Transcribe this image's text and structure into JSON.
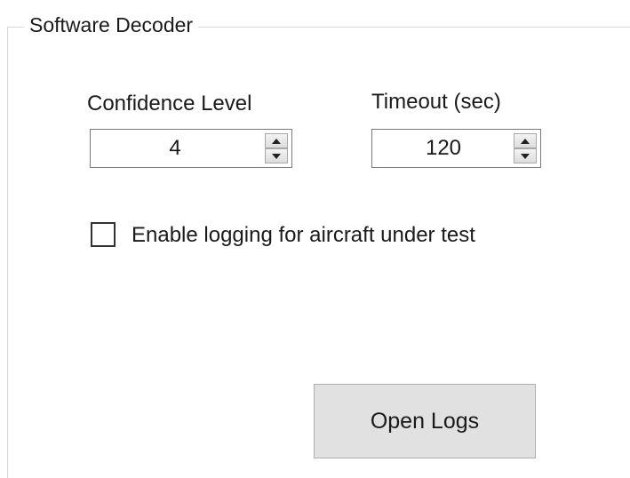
{
  "group": {
    "title": "Software Decoder"
  },
  "confidence": {
    "label": "Confidence Level",
    "value": "4"
  },
  "timeout": {
    "label": "Timeout (sec)",
    "value": "120"
  },
  "logging": {
    "label": "Enable logging for aircraft under test",
    "checked": false
  },
  "actions": {
    "open_logs_label": "Open Logs"
  },
  "icons": {
    "spin_up": "chevron-up-icon",
    "spin_down": "chevron-down-icon"
  },
  "colors": {
    "button_face": "#e1e1e1",
    "border": "#7a7a7a"
  }
}
